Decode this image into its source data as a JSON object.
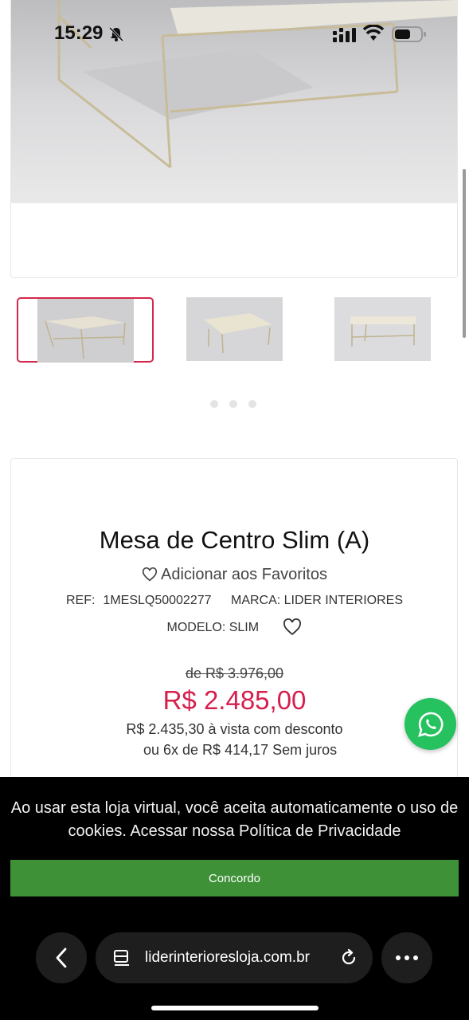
{
  "status": {
    "time": "15:29"
  },
  "product": {
    "title": "Mesa de Centro Slim (A)",
    "favorite_label": "Adicionar aos Favoritos",
    "ref_label": "REF:",
    "ref_value": "1MESLQ50002277",
    "brand": "MARCA: LIDER INTERIORES",
    "model": "MODELO: SLIM",
    "old_price": "de R$ 3.976,00",
    "price": "R$ 2.485,00",
    "cash_price": "R$ 2.435,30 à vista com desconto",
    "installments": "ou 6x de R$ 414,17 Sem juros"
  },
  "carousel": {
    "dot_count": 3
  },
  "cookie": {
    "text": "Ao usar esta loja virtual, você aceita automaticamente o uso de cookies. Acessar nossa Política de Privacidade",
    "agree_label": "Concordo"
  },
  "browser": {
    "url": "liderinterioresloja.com.br"
  },
  "colors": {
    "price": "#d51f4d",
    "agree_button": "#3f9138",
    "whatsapp": "#25c25f"
  }
}
